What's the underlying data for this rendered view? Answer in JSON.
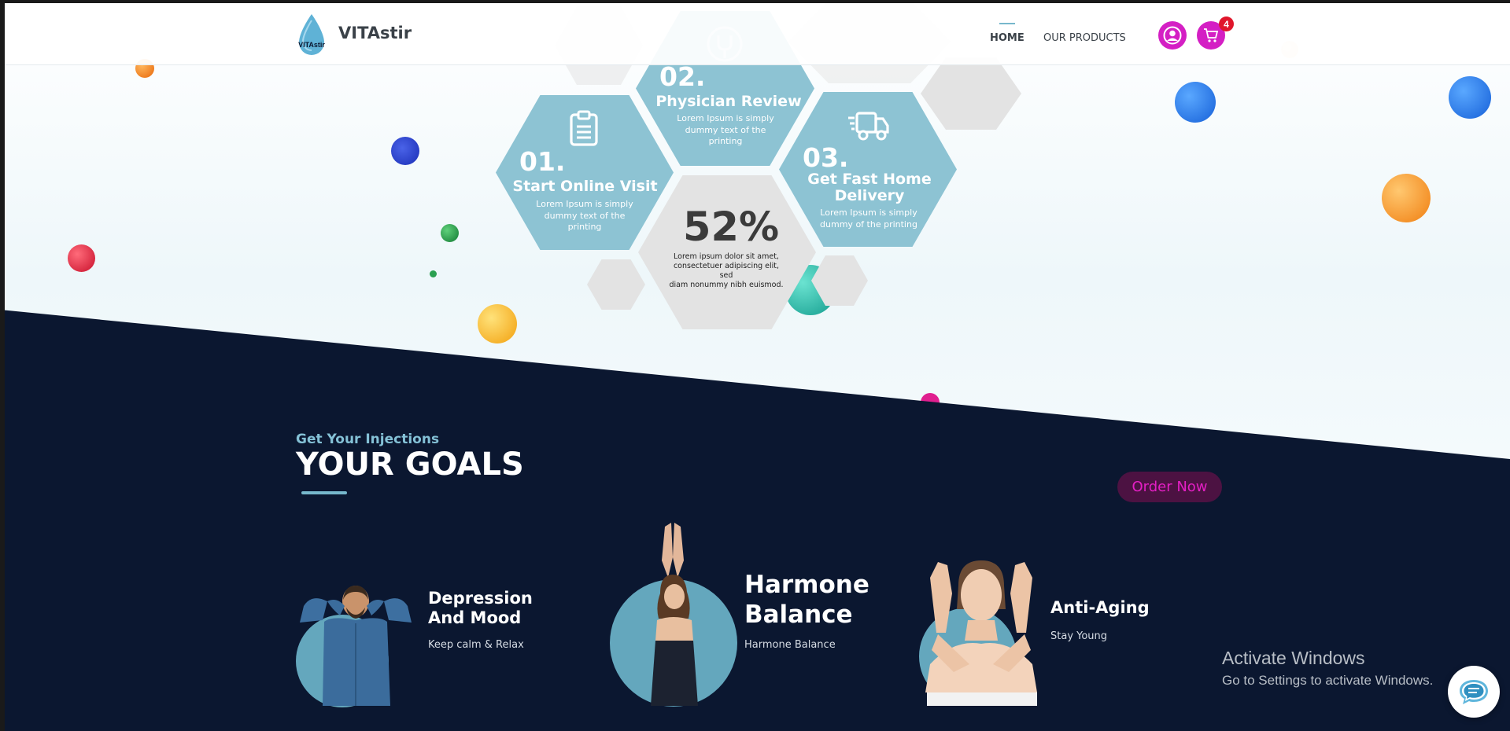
{
  "header": {
    "logo_text": "VITAstir",
    "brand": "VITAstir",
    "nav": {
      "home": "HOME",
      "products": "OUR PRODUCTS"
    },
    "cart_count": "4"
  },
  "steps": [
    {
      "number": "01.",
      "title": "Start Online Visit",
      "body_lines": [
        "Lorem Ipsum is simply",
        "dummy text of the",
        "printing"
      ],
      "icon": "clipboard-icon"
    },
    {
      "number": "02.",
      "title": "Physician Review",
      "body_lines": [
        "Lorem Ipsum is simply",
        "dummy text of the",
        "printing"
      ],
      "icon": "stethoscope-icon"
    },
    {
      "number": "03.",
      "title_lines": [
        "Get Fast Home",
        "Delivery"
      ],
      "body_lines": [
        "Lorem Ipsum is simply",
        "dummy of the printing"
      ],
      "icon": "delivery-truck-icon"
    }
  ],
  "stat": {
    "value": "52%",
    "body_lines": [
      "Lorem ipsum dolor sit amet,",
      "consectetuer adipiscing elit, sed",
      "diam nonummy nibh euismod."
    ]
  },
  "goals": {
    "subtitle": "Get Your Injections",
    "title": "YOUR GOALS",
    "order_button": "Order Now",
    "items": [
      {
        "title_lines": [
          "Depression",
          "And Mood"
        ],
        "subtitle": "Keep calm & Relax"
      },
      {
        "title_lines": [
          "Harmone",
          "Balance"
        ],
        "subtitle": "Harmone Balance"
      },
      {
        "title_lines": [
          "Anti-Aging"
        ],
        "subtitle": "Stay Young"
      }
    ]
  },
  "watermark": {
    "title": "Activate Windows",
    "subtitle": "Go to Settings to activate Windows."
  },
  "colors": {
    "accent_blue": "#8dc3d3",
    "magenta": "#d41fc4",
    "dark_navy": "#0b1730",
    "badge_red": "#e0162b"
  },
  "icons": [
    "user-icon",
    "cart-icon",
    "chat-icon"
  ]
}
